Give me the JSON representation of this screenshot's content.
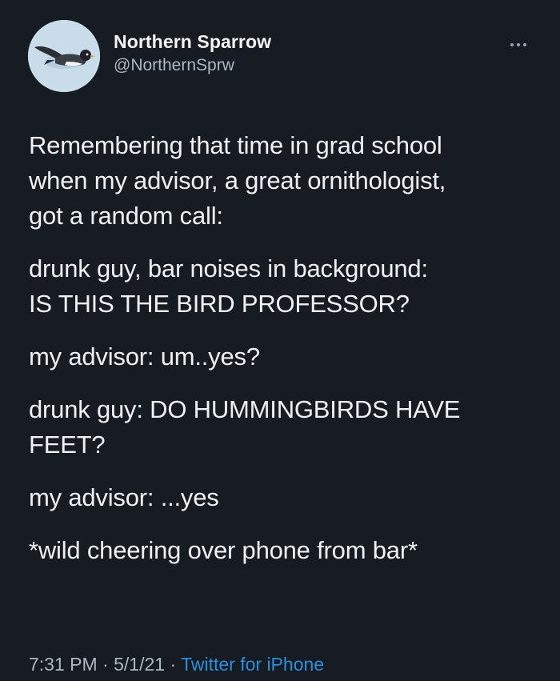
{
  "author": {
    "display_name": "Northern Sparrow",
    "handle": "@NorthernSprw"
  },
  "paragraphs": [
    "Remembering that time in grad school\nwhen my advisor, a great ornithologist,\ngot a random call:",
    "drunk guy, bar noises in background:\nIS THIS THE BIRD PROFESSOR?",
    "my advisor: um..yes?",
    "drunk guy: DO HUMMINGBIRDS HAVE\nFEET?",
    "my advisor: ...yes",
    "*wild cheering over phone from bar*"
  ],
  "footer": {
    "time": "7:31 PM",
    "separator": " · ",
    "date": "5/1/21",
    "source": "Twitter for iPhone"
  },
  "icons": {
    "avatar": "bird-avatar-icon",
    "more": "more-options-icon"
  },
  "colors": {
    "background": "#171c23",
    "text": "#eef0f2",
    "secondary_text": "#aeb6bf",
    "link": "#2b8fde"
  }
}
